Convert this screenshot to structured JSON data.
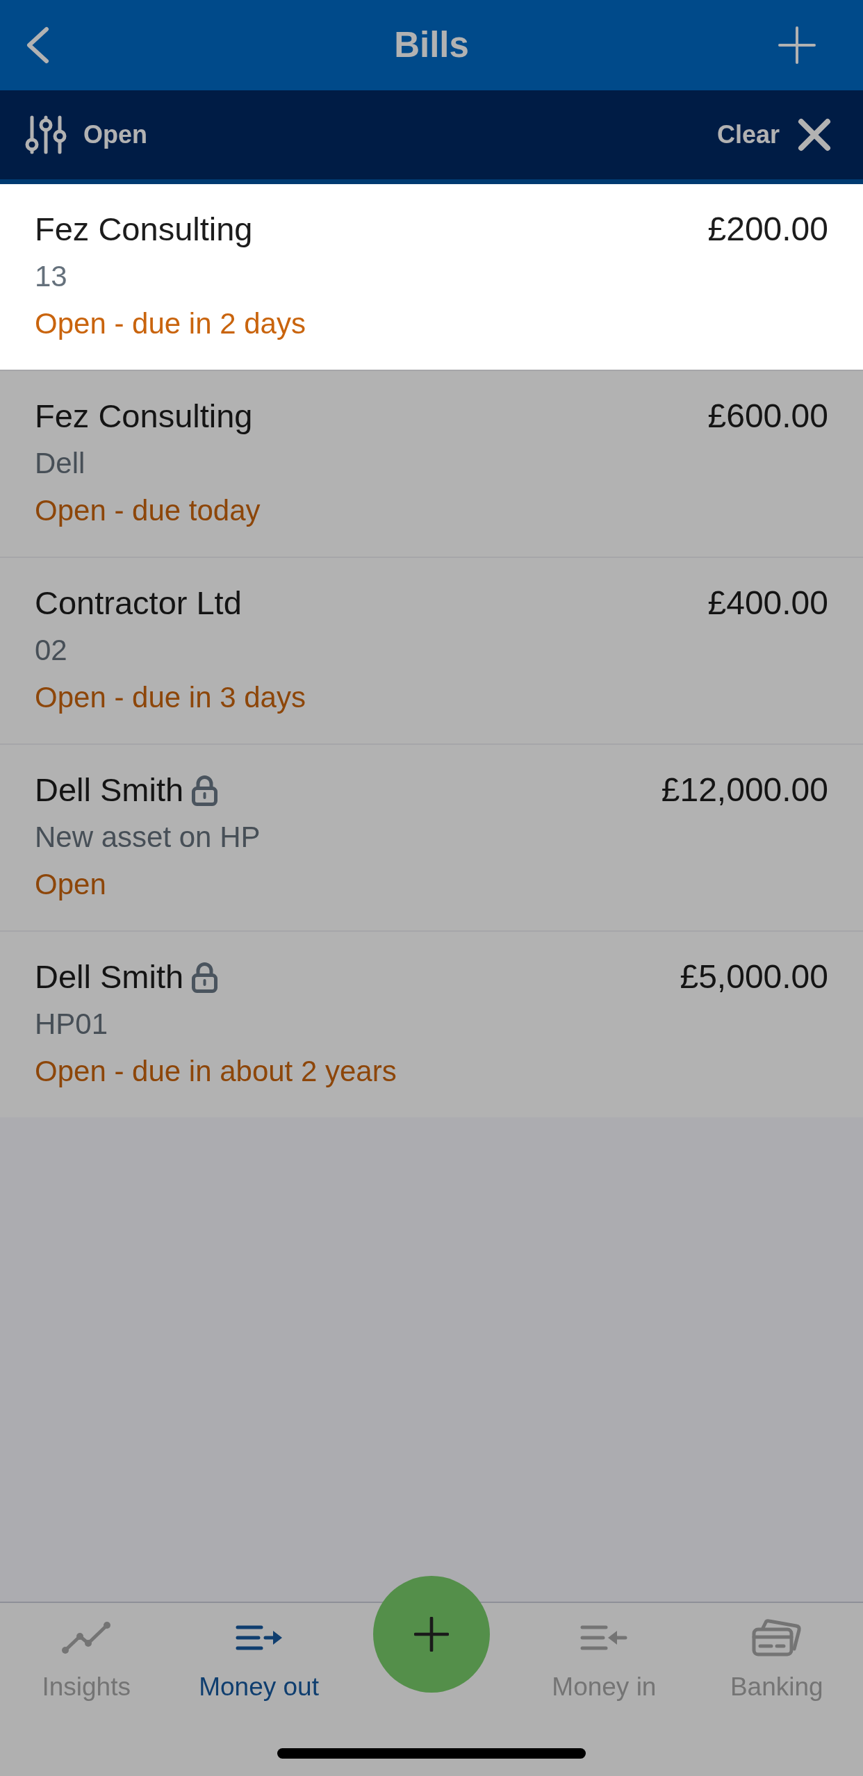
{
  "screen": {
    "dimmed": true
  },
  "header": {
    "title": "Bills"
  },
  "filter_bar": {
    "filter": "Open",
    "clear": "Clear"
  },
  "bills": [
    {
      "payee": "Fez Consulting",
      "locked": false,
      "reference": "13",
      "status": "Open - due in 2 days",
      "amount": "£200.00",
      "highlighted": true
    },
    {
      "payee": "Fez Consulting",
      "locked": false,
      "reference": "Dell",
      "status": "Open - due today",
      "amount": "£600.00",
      "highlighted": false
    },
    {
      "payee": "Contractor Ltd",
      "locked": false,
      "reference": "02",
      "status": "Open - due in 3 days",
      "amount": "£400.00",
      "highlighted": false
    },
    {
      "payee": "Dell Smith",
      "locked": true,
      "reference": "New asset on HP",
      "status": "Open",
      "amount": "£12,000.00",
      "highlighted": false
    },
    {
      "payee": "Dell Smith",
      "locked": true,
      "reference": "HP01",
      "status": "Open - due in about 2 years",
      "amount": "£5,000.00",
      "highlighted": false
    }
  ],
  "tab_bar": {
    "items": [
      {
        "kind": "tab",
        "label": "Insights",
        "selected": false
      },
      {
        "kind": "tab",
        "label": "Money out",
        "selected": true
      },
      {
        "kind": "action"
      },
      {
        "kind": "tab",
        "label": "Money in",
        "selected": false
      },
      {
        "kind": "tab",
        "label": "Banking",
        "selected": false
      }
    ]
  }
}
